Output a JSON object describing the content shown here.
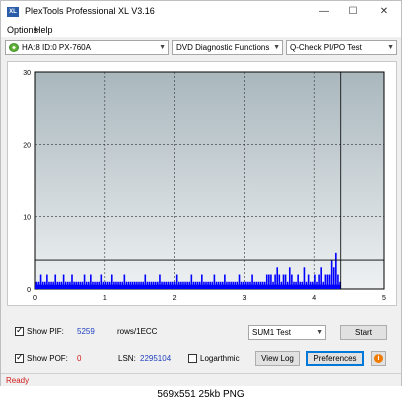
{
  "window": {
    "title": "PlexTools Professional XL V3.16",
    "app_icon_text": "XL",
    "minimize_glyph": "—",
    "maximize_glyph": "☐",
    "close_glyph": "✕"
  },
  "menu": {
    "options": "Options",
    "help": "Help"
  },
  "toolbar": {
    "drive": "HA:8 ID:0  PX-760A",
    "function": "DVD Diagnostic Functions",
    "test": "Q-Check PI/PO Test"
  },
  "controls": {
    "show_pif_label": "Show PIF:",
    "pif_value": "5259",
    "pif_unit": "rows/1ECC",
    "show_pof_label": "Show POF:",
    "pof_value": "0",
    "lsn_label": "LSN:",
    "lsn_value": "2295104",
    "logarithmic_label": "Logarthmic",
    "sum_select": "SUM1 Test",
    "start_button": "Start",
    "view_log_button": "View Log",
    "preferences_button": "Preferences",
    "info_glyph": "i"
  },
  "status": {
    "text": "Ready"
  },
  "caption": {
    "text": "569x551  25kb  PNG"
  },
  "colors": {
    "plot_bg_top": "#a9b7bd",
    "plot_bg_bottom": "#eef1f2",
    "series": "#0000ff",
    "threshold": "#000000",
    "status_text": "#d11a1a"
  },
  "chart_data": {
    "type": "bar",
    "xlim": [
      0,
      5
    ],
    "ylim": [
      0,
      30
    ],
    "x_ticks": [
      "0",
      "1",
      "2",
      "3",
      "4",
      "5"
    ],
    "y_ticks": [
      "0",
      "10",
      "20",
      "30"
    ],
    "grid": true,
    "threshold_y": 4,
    "end_marker_x": 4.38,
    "series": [
      {
        "x": [
          0.02,
          0.05,
          0.08,
          0.11,
          0.14,
          0.17,
          0.2,
          0.23,
          0.26,
          0.29,
          0.32,
          0.35,
          0.38,
          0.41,
          0.44,
          0.47,
          0.5,
          0.53,
          0.56,
          0.59,
          0.62,
          0.65,
          0.68,
          0.71,
          0.74,
          0.77,
          0.8,
          0.83,
          0.86,
          0.89,
          0.92,
          0.95,
          0.98,
          1.01,
          1.04,
          1.07,
          1.1,
          1.13,
          1.16,
          1.19,
          1.22,
          1.25,
          1.28,
          1.31,
          1.34,
          1.37,
          1.4,
          1.43,
          1.46,
          1.49,
          1.52,
          1.55,
          1.58,
          1.61,
          1.64,
          1.67,
          1.7,
          1.73,
          1.76,
          1.79,
          1.82,
          1.85,
          1.88,
          1.91,
          1.94,
          1.97,
          2.0,
          2.03,
          2.06,
          2.09,
          2.12,
          2.15,
          2.18,
          2.21,
          2.24,
          2.27,
          2.3,
          2.33,
          2.36,
          2.39,
          2.42,
          2.45,
          2.48,
          2.51,
          2.54,
          2.57,
          2.6,
          2.63,
          2.66,
          2.69,
          2.72,
          2.75,
          2.78,
          2.81,
          2.84,
          2.87,
          2.9,
          2.93,
          2.96,
          2.99,
          3.02,
          3.05,
          3.08,
          3.11,
          3.14,
          3.17,
          3.2,
          3.23,
          3.26,
          3.29,
          3.32,
          3.35,
          3.38,
          3.41,
          3.44,
          3.47,
          3.5,
          3.53,
          3.56,
          3.59,
          3.62,
          3.65,
          3.68,
          3.71,
          3.74,
          3.77,
          3.8,
          3.83,
          3.86,
          3.89,
          3.92,
          3.95,
          3.98,
          4.01,
          4.04,
          4.07,
          4.1,
          4.13,
          4.16,
          4.19,
          4.22,
          4.25,
          4.28,
          4.31,
          4.34,
          4.37
        ],
        "values": [
          1,
          1,
          2,
          1,
          1,
          2,
          1,
          1,
          1,
          2,
          1,
          1,
          1,
          2,
          1,
          1,
          1,
          2,
          1,
          1,
          1,
          1,
          1,
          2,
          1,
          1,
          2,
          1,
          1,
          1,
          1,
          2,
          1,
          1,
          1,
          1,
          2,
          1,
          1,
          1,
          1,
          1,
          2,
          1,
          1,
          1,
          1,
          1,
          1,
          1,
          1,
          1,
          2,
          1,
          1,
          1,
          1,
          1,
          1,
          2,
          1,
          1,
          1,
          1,
          1,
          1,
          1,
          2,
          1,
          1,
          1,
          1,
          1,
          1,
          2,
          1,
          1,
          1,
          1,
          2,
          1,
          1,
          1,
          1,
          1,
          2,
          1,
          1,
          1,
          1,
          2,
          1,
          1,
          1,
          1,
          1,
          1,
          2,
          1,
          1,
          1,
          1,
          1,
          2,
          1,
          1,
          1,
          1,
          1,
          1,
          2,
          2,
          2,
          1,
          2,
          3,
          2,
          1,
          2,
          2,
          1,
          3,
          2,
          1,
          1,
          2,
          1,
          1,
          3,
          1,
          2,
          1,
          1,
          2,
          1,
          2,
          3,
          1,
          2,
          2,
          2,
          4,
          3,
          5,
          2,
          1
        ]
      }
    ]
  }
}
